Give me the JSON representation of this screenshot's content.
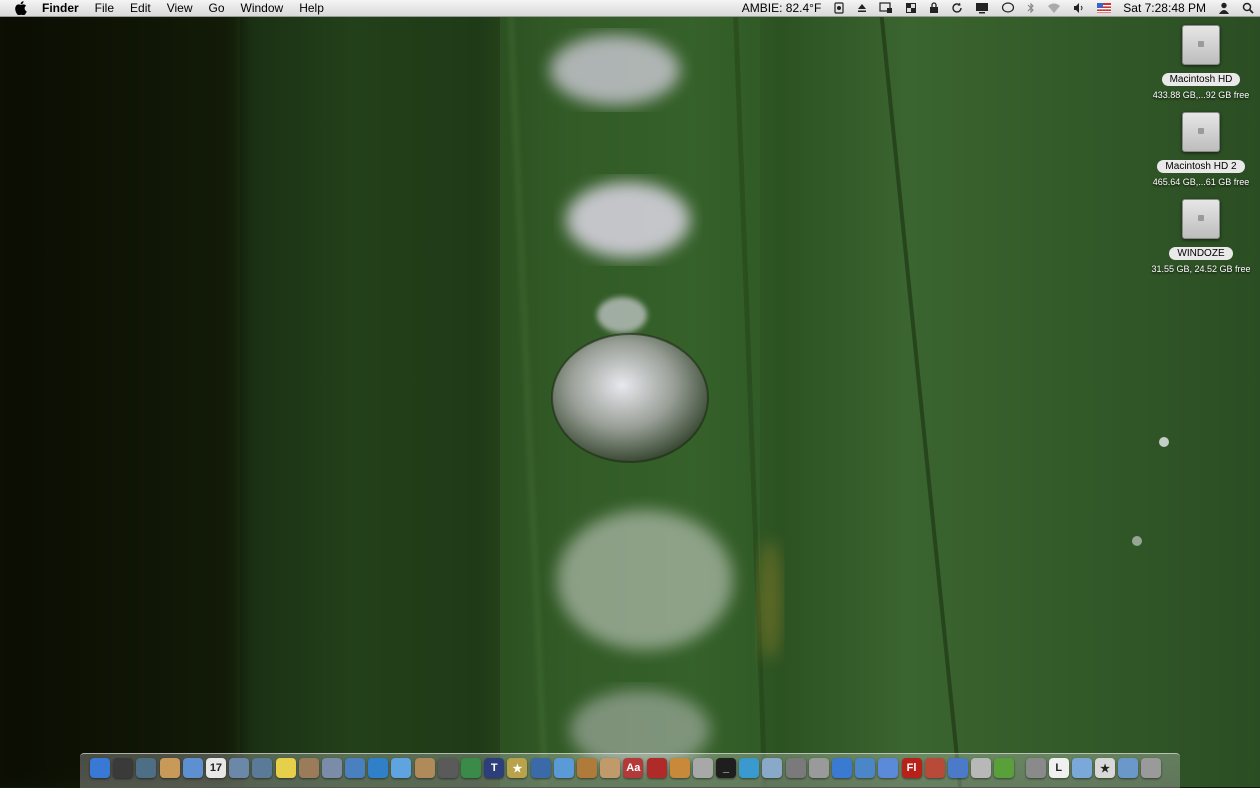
{
  "menubar": {
    "app_name": "Finder",
    "menus": [
      "File",
      "Edit",
      "View",
      "Go",
      "Window",
      "Help"
    ],
    "weather": "AMBIE: 82.4°F",
    "clock": "Sat 7:28:48 PM",
    "status_icons": [
      "alarm-icon",
      "eject-icon",
      "display-icon",
      "spaces-icon",
      "lock-icon",
      "sync-icon",
      "screen-icon",
      "chat-icon",
      "bluetooth-icon",
      "wifi-icon",
      "volume-icon",
      "us-flag-icon",
      "user-icon",
      "spotlight-icon"
    ]
  },
  "volumes": [
    {
      "name": "Macintosh HD",
      "info": "433.88 GB,...92 GB free"
    },
    {
      "name": "Macintosh HD 2",
      "info": "465.64 GB,...61 GB free"
    },
    {
      "name": "WINDOZE",
      "info": "31.55 GB, 24.52 GB free"
    }
  ],
  "dock": {
    "apps": [
      {
        "name": "finder-icon",
        "glyph": "",
        "color": "#3a78d6"
      },
      {
        "name": "dashboard-icon",
        "glyph": "",
        "color": "#3a3a3a"
      },
      {
        "name": "time-machine-icon",
        "glyph": "",
        "color": "#4e6e86"
      },
      {
        "name": "address-book-icon",
        "glyph": "",
        "color": "#c89a5a"
      },
      {
        "name": "mail-icon",
        "glyph": "",
        "color": "#5e8fd0"
      },
      {
        "name": "ical-icon",
        "glyph": "17",
        "color": "#e8e8e8"
      },
      {
        "name": "network-icon",
        "glyph": "",
        "color": "#6b88a8"
      },
      {
        "name": "network-2-icon",
        "glyph": "",
        "color": "#5a7a98"
      },
      {
        "name": "stickies-icon",
        "glyph": "",
        "color": "#e6cf4a"
      },
      {
        "name": "preview-icon",
        "glyph": "",
        "color": "#9a7c5a"
      },
      {
        "name": "pen-icon",
        "glyph": "",
        "color": "#7a8ca8"
      },
      {
        "name": "chart-icon",
        "glyph": "",
        "color": "#4a7fc0"
      },
      {
        "name": "quicktime-icon",
        "glyph": "",
        "color": "#2f7fc9"
      },
      {
        "name": "itunes-icon",
        "glyph": "",
        "color": "#5fa4e0"
      },
      {
        "name": "iphoto-icon",
        "glyph": "",
        "color": "#b08a5a"
      },
      {
        "name": "imovie-icon",
        "glyph": "",
        "color": "#5a5a5a"
      },
      {
        "name": "dvd-icon",
        "glyph": "",
        "color": "#3a8a4a"
      },
      {
        "name": "idvd-icon",
        "glyph": "T",
        "color": "#2d3f7a"
      },
      {
        "name": "star-icon",
        "glyph": "★",
        "color": "#b8a24a"
      },
      {
        "name": "film-icon",
        "glyph": "",
        "color": "#3a6aa8"
      },
      {
        "name": "iweb-icon",
        "glyph": "",
        "color": "#5a9ad6"
      },
      {
        "name": "garageband-icon",
        "glyph": "",
        "color": "#b07a3a"
      },
      {
        "name": "photos-icon",
        "glyph": "",
        "color": "#c09a6a"
      },
      {
        "name": "dictionary-icon",
        "glyph": "Aa",
        "color": "#b43a3a"
      },
      {
        "name": "book-icon",
        "glyph": "",
        "color": "#b02a2a"
      },
      {
        "name": "text-edit-icon",
        "glyph": "",
        "color": "#c88a3a"
      },
      {
        "name": "calculator-icon",
        "glyph": "",
        "color": "#a8a8a8"
      },
      {
        "name": "terminal-icon",
        "glyph": "_",
        "color": "#1e1e1e"
      },
      {
        "name": "safari-icon",
        "glyph": "",
        "color": "#3a9ad0"
      },
      {
        "name": "monitor-icon",
        "glyph": "",
        "color": "#8aa8c8"
      },
      {
        "name": "disk-icon",
        "glyph": "",
        "color": "#7a7a7a"
      },
      {
        "name": "disk-2-icon",
        "glyph": "",
        "color": "#9a9a9a"
      },
      {
        "name": "ftp-icon",
        "glyph": "",
        "color": "#3a7ad0"
      },
      {
        "name": "xcode-icon",
        "glyph": "",
        "color": "#4a86c8"
      },
      {
        "name": "interface-builder-icon",
        "glyph": "",
        "color": "#5a8ad8"
      },
      {
        "name": "flash-icon",
        "glyph": "Fl",
        "color": "#b8201a"
      },
      {
        "name": "utility-icon",
        "glyph": "",
        "color": "#b84a3a"
      },
      {
        "name": "safari-2-icon",
        "glyph": "",
        "color": "#4a7ac8"
      },
      {
        "name": "printer-icon",
        "glyph": "",
        "color": "#b8b8b8"
      },
      {
        "name": "gear-icon",
        "glyph": "",
        "color": "#5aa03a"
      },
      {
        "name": "settings-icon",
        "glyph": "",
        "color": "#8a8a8a"
      },
      {
        "name": "document-icon",
        "glyph": "L",
        "color": "#f0f0f0"
      },
      {
        "name": "applications-folder-icon",
        "glyph": "",
        "color": "#7aa8d8"
      },
      {
        "name": "favorites-icon",
        "glyph": "★",
        "color": "#d8d8d8"
      },
      {
        "name": "folder-icon",
        "glyph": "",
        "color": "#6a98c8"
      },
      {
        "name": "trash-icon",
        "glyph": "",
        "color": "#9a9a9a"
      }
    ]
  }
}
